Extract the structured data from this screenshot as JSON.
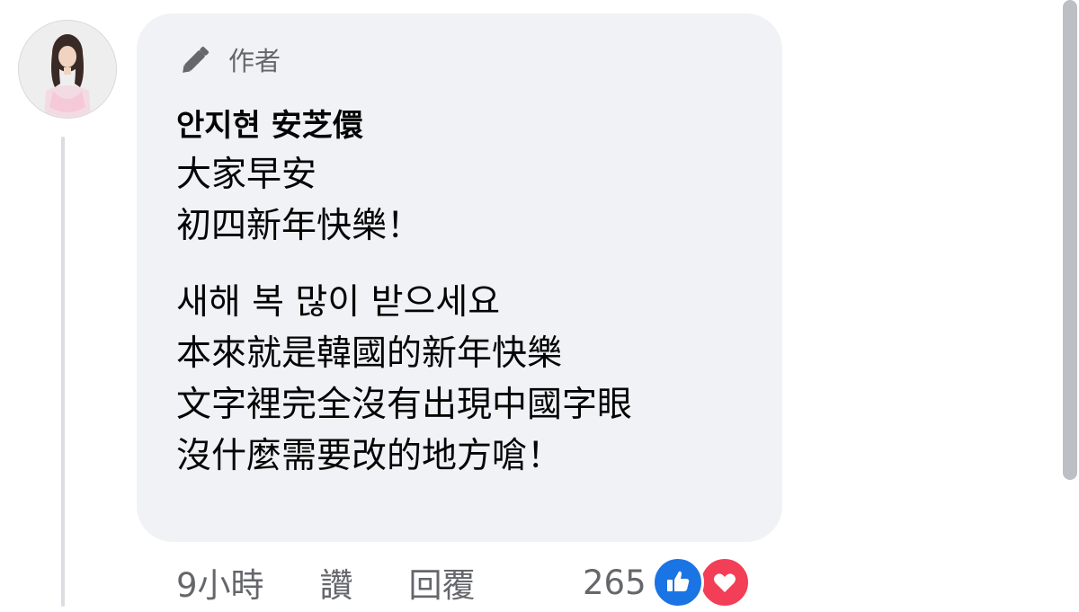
{
  "comment": {
    "avatar_icon": "avatar",
    "author_badge": {
      "icon": "pen-icon",
      "label": "作者"
    },
    "commenter_name": "안지현 安芝儇",
    "lines": [
      "大家早安",
      "初四新年快樂！",
      "새해 복 많이 받으세요",
      "本來就是韓國的新年快樂",
      "文字裡完全沒有出現中國字眼",
      "沒什麼需要改的地方嗆！"
    ]
  },
  "actions": {
    "timestamp": "9小時",
    "like_label": "讚",
    "reply_label": "回覆"
  },
  "reactions": {
    "count": "265",
    "icons": [
      "like-icon",
      "love-icon"
    ],
    "like_color": "#1b74e4",
    "love_color": "#f33e58"
  },
  "colors": {
    "bubble_bg": "#f0f2f5",
    "secondary_text": "#65676b",
    "primary_text": "#050505"
  }
}
